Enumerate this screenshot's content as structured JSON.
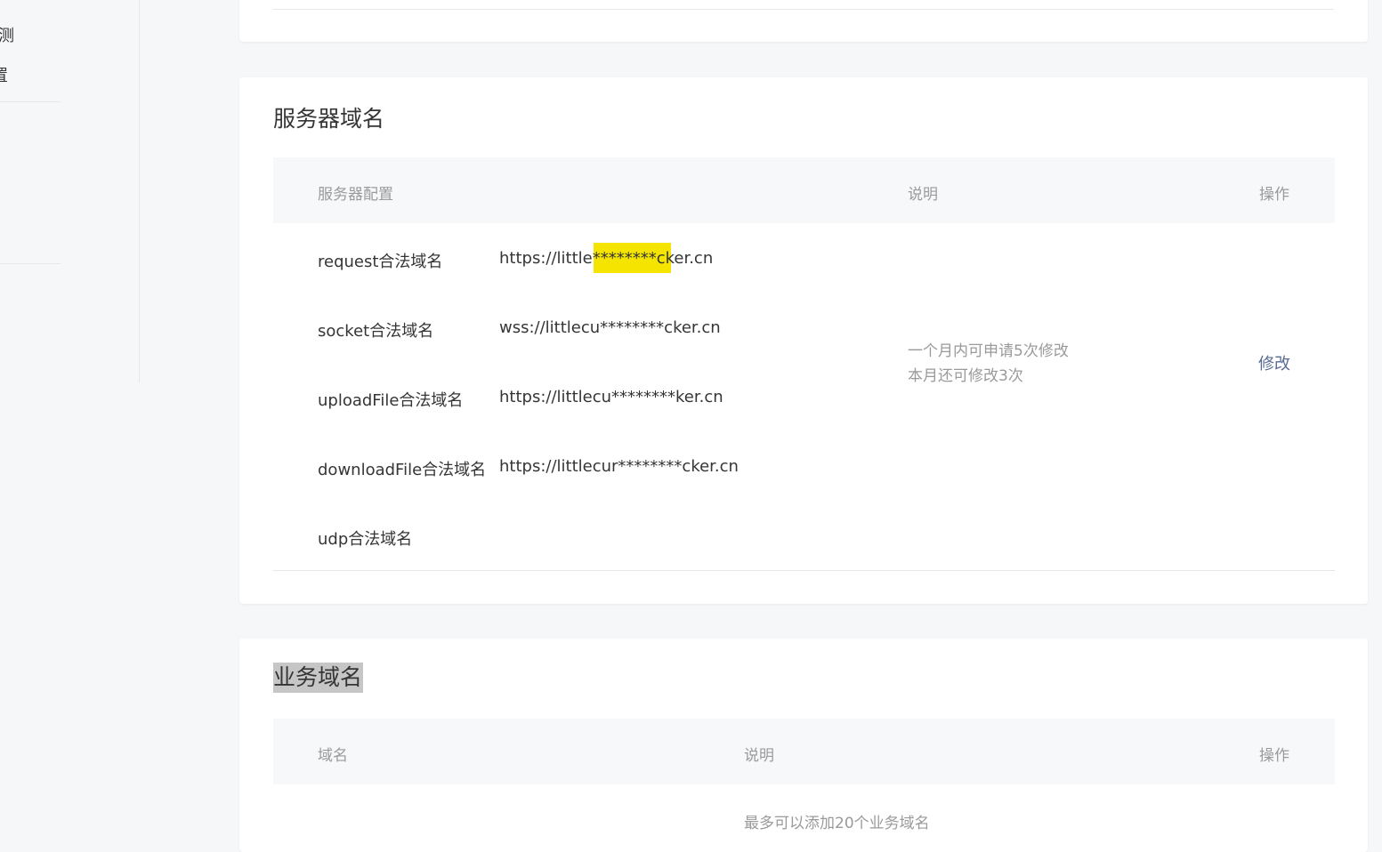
{
  "sidebar": {
    "items": [
      {
        "label": "测"
      },
      {
        "label": "置"
      }
    ]
  },
  "server_domain": {
    "title": "服务器域名",
    "headers": {
      "config": "服务器配置",
      "desc": "说明",
      "op": "操作"
    },
    "rows": [
      {
        "label": "request合法域名",
        "value": "https://little********cker.cn"
      },
      {
        "label": "socket合法域名",
        "value": "wss://littlecu********cker.cn"
      },
      {
        "label": "uploadFile合法域名",
        "value": "https://littlecu********ker.cn"
      },
      {
        "label": "downloadFile合法域名",
        "value": "https://littlecur********cker.cn"
      },
      {
        "label": "udp合法域名",
        "value": ""
      }
    ],
    "desc_line1": "一个月内可申请5次修改",
    "desc_line2": "本月还可修改3次",
    "modify_label": "修改"
  },
  "business_domain": {
    "title": "业务域名",
    "headers": {
      "domain": "域名",
      "desc": "说明",
      "op": "操作"
    },
    "hint": "最多可以添加20个业务域名"
  },
  "colors": {
    "link": "#576b95",
    "highlight": "#f5e400",
    "muted": "#9a9a9a"
  }
}
